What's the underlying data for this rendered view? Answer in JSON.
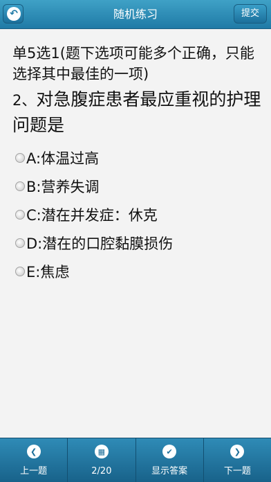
{
  "header": {
    "title": "随机练习",
    "submit_label": "提交"
  },
  "question": {
    "type_label": "单5选1(题下选项可能多个正确，只能选择其中最佳的一项)",
    "number": "2、",
    "text": "对急腹症患者最应重视的护理问题是"
  },
  "options": [
    {
      "label": "A:体温过高"
    },
    {
      "label": "B:营养失调"
    },
    {
      "label": "C:潜在并发症：休克"
    },
    {
      "label": "D:潜在的口腔黏膜损伤"
    },
    {
      "label": "E:焦虑"
    }
  ],
  "footer": {
    "prev_label": "上一题",
    "progress_label": "2/20",
    "show_answer_label": "显示答案",
    "next_label": "下一题"
  },
  "colors": {
    "header": "#1f7aa6",
    "footer": "#18628a",
    "background": "#f3f3f3"
  }
}
